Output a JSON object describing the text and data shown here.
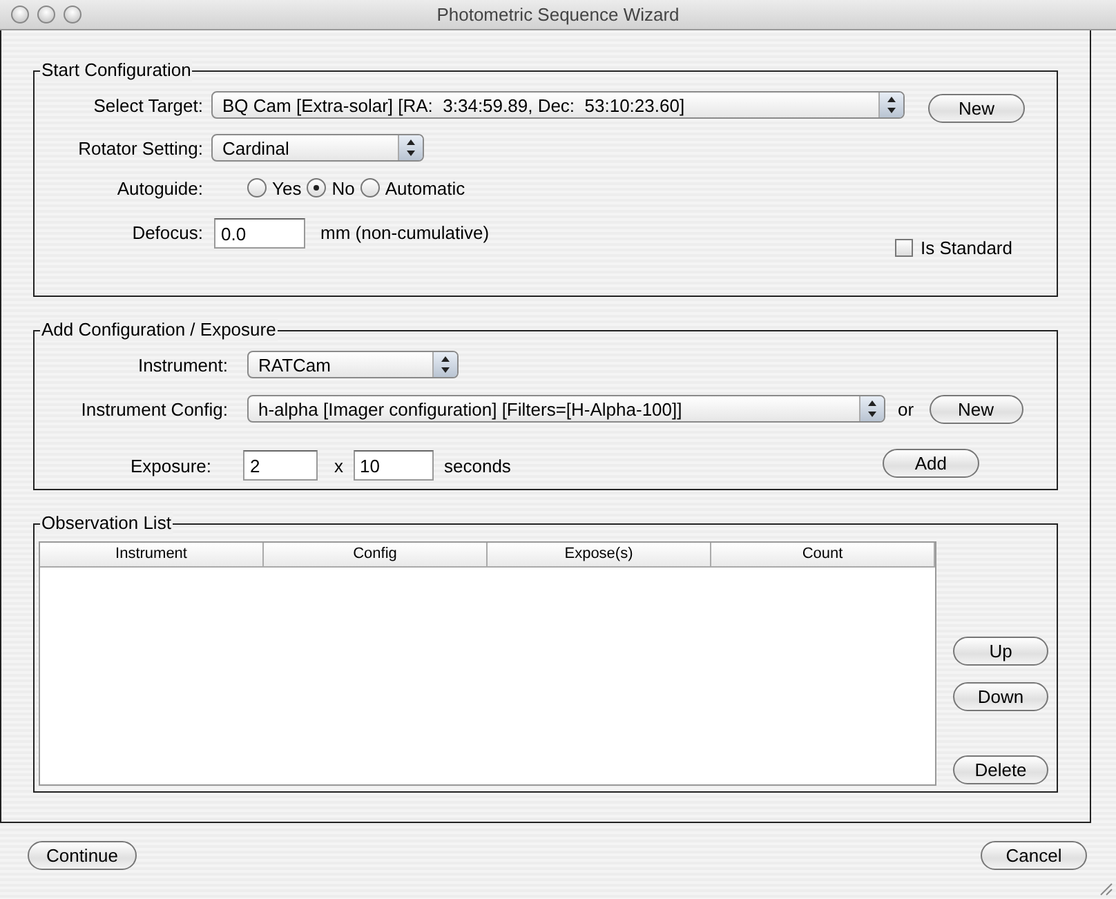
{
  "window": {
    "title": "Photometric Sequence Wizard"
  },
  "start_configuration": {
    "title": "Start Configuration",
    "target": {
      "label": "Select Target:",
      "value": "BQ Cam [Extra-solar] [RA:  3:34:59.89, Dec:  53:10:23.60]"
    },
    "new_button": "New",
    "rotator": {
      "label": "Rotator Setting:",
      "value": "Cardinal"
    },
    "autoguide": {
      "label": "Autoguide:",
      "options": [
        {
          "label": "Yes",
          "selected": false
        },
        {
          "label": "No",
          "selected": true
        },
        {
          "label": "Automatic",
          "selected": false
        }
      ]
    },
    "defocus": {
      "label": "Defocus:",
      "value": "0.0",
      "unit": "mm (non-cumulative)"
    },
    "is_standard": {
      "label": "Is Standard",
      "checked": false
    }
  },
  "add_configuration": {
    "title": "Add Configuration / Exposure",
    "instrument": {
      "label": "Instrument:",
      "value": "RATCam"
    },
    "instrument_config": {
      "label": "Instrument Config:",
      "value": "h-alpha [Imager configuration] [Filters=[H-Alpha-100]]",
      "or": "or"
    },
    "new_button": "New",
    "exposure": {
      "label": "Exposure:",
      "time": "2",
      "times": "x",
      "count": "10",
      "unit": "seconds"
    },
    "add_button": "Add"
  },
  "observation_list": {
    "title": "Observation List",
    "columns": [
      "Instrument",
      "Config",
      "Expose(s)",
      "Count"
    ],
    "buttons": [
      "Up",
      "Down",
      "Delete"
    ]
  },
  "footer": {
    "continue_button": "Continue",
    "cancel_button": "Cancel"
  }
}
